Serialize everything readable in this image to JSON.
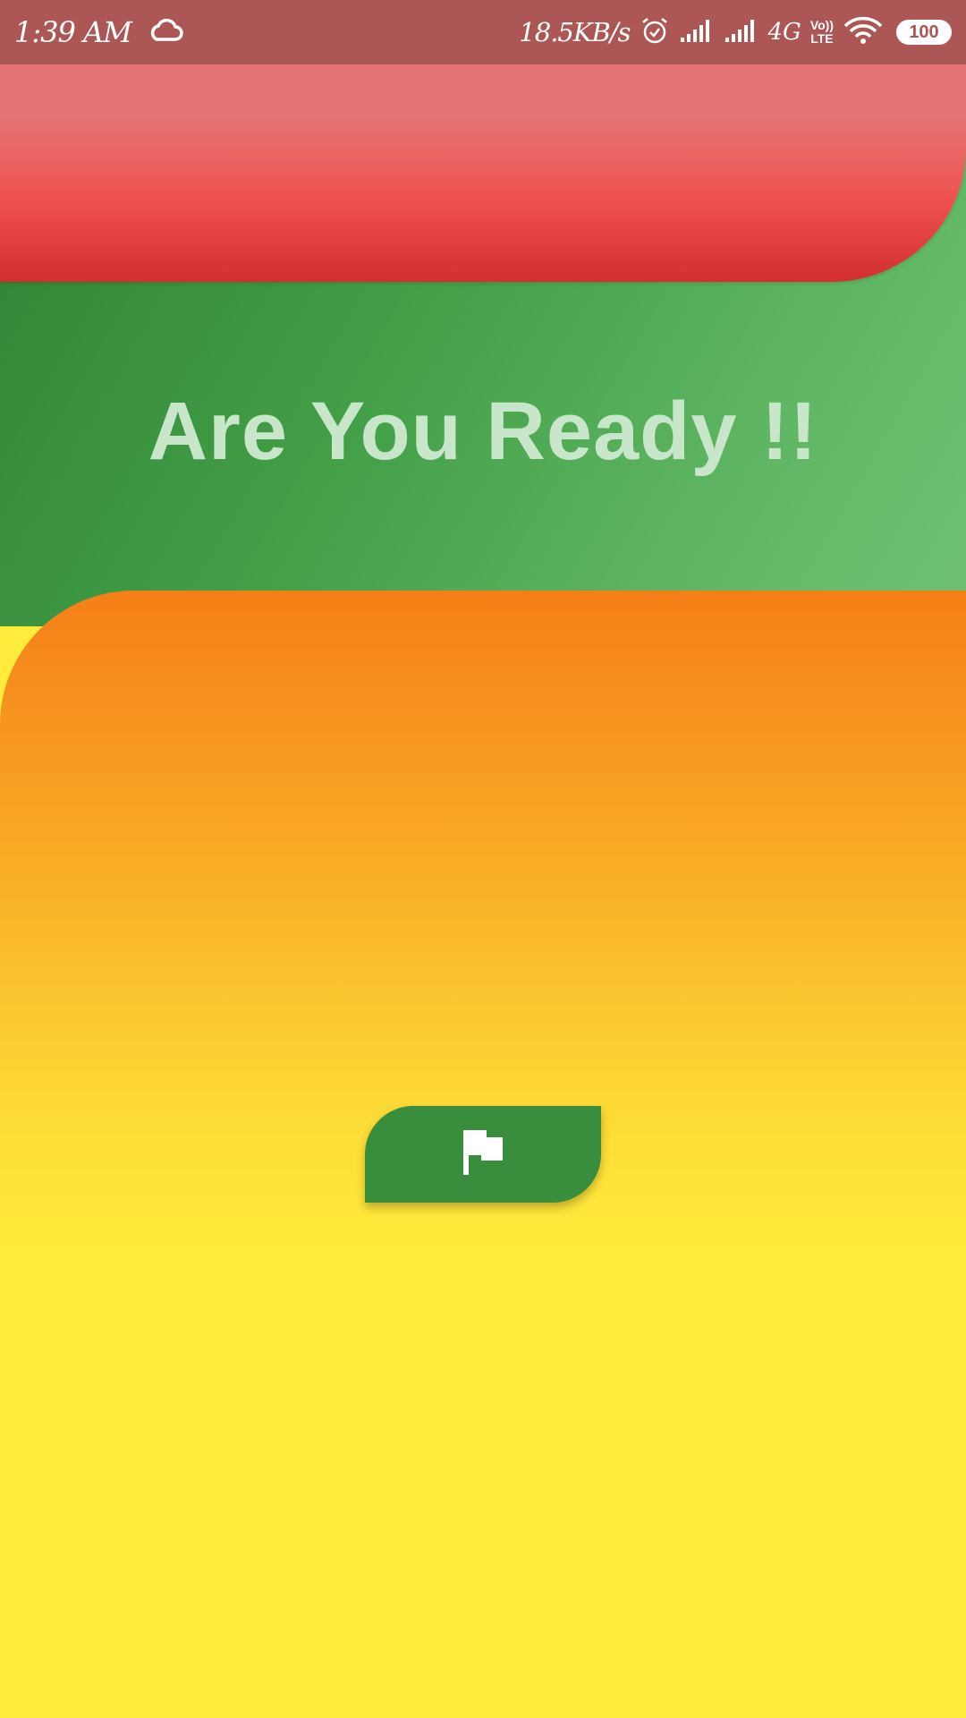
{
  "status_bar": {
    "time": "1:39 AM",
    "net_speed": "18.5KB/s",
    "network_type": "4G",
    "volte_top": "Vo))",
    "volte_bottom": "LTE",
    "battery": "100",
    "icons": [
      "cloud-icon",
      "alarm-icon",
      "signal-icon",
      "signal-icon",
      "wifi-icon",
      "battery-icon"
    ]
  },
  "main": {
    "headline": "Are You Ready !!",
    "start_button": {
      "icon": "flag-icon"
    }
  },
  "colors": {
    "status_bar": "#ad5656",
    "red_band": "#ef5350",
    "green_band": "#43a047",
    "headline_text": "#c8e6c9",
    "orange": "#f57f17",
    "yellow": "#ffeb3b",
    "button": "#388e3c"
  }
}
